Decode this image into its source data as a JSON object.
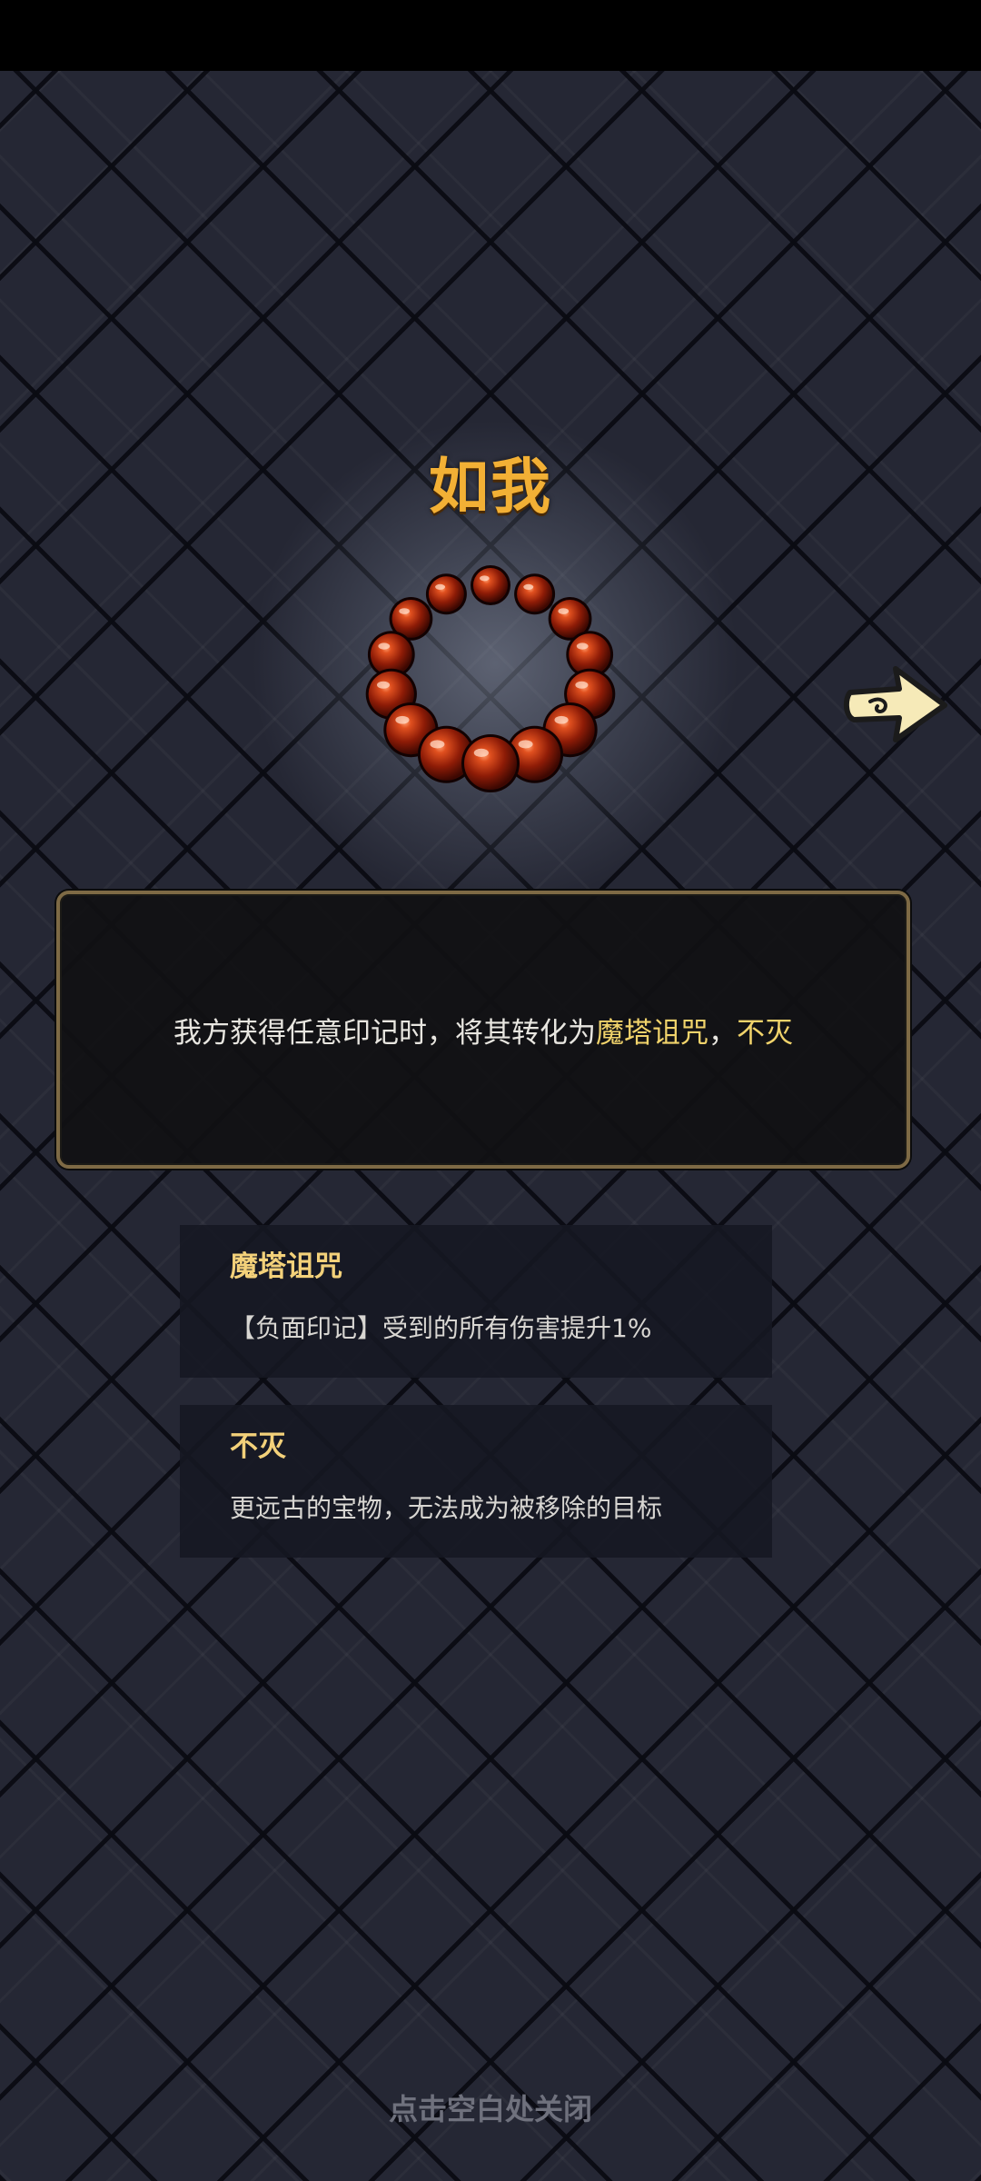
{
  "item": {
    "name": "如我",
    "description_parts": [
      "我方获得任意印记时，将其转化为",
      "魔塔诅咒",
      "，",
      "不灭"
    ]
  },
  "keywords": [
    {
      "title": "魔塔诅咒",
      "desc": "【负面印记】受到的所有伤害提升1%"
    },
    {
      "title": "不灭",
      "desc": "更远古的宝物，无法成为被移除的目标"
    }
  ],
  "close_hint": "点击空白处关闭",
  "icons": {
    "item": "prayer-bead-bracelet-icon",
    "next": "arrow-right-icon"
  },
  "colors": {
    "title": "#f2b035",
    "keyword": "#f1d36b",
    "panel_border": "#7e6a45",
    "background": "#252734"
  }
}
